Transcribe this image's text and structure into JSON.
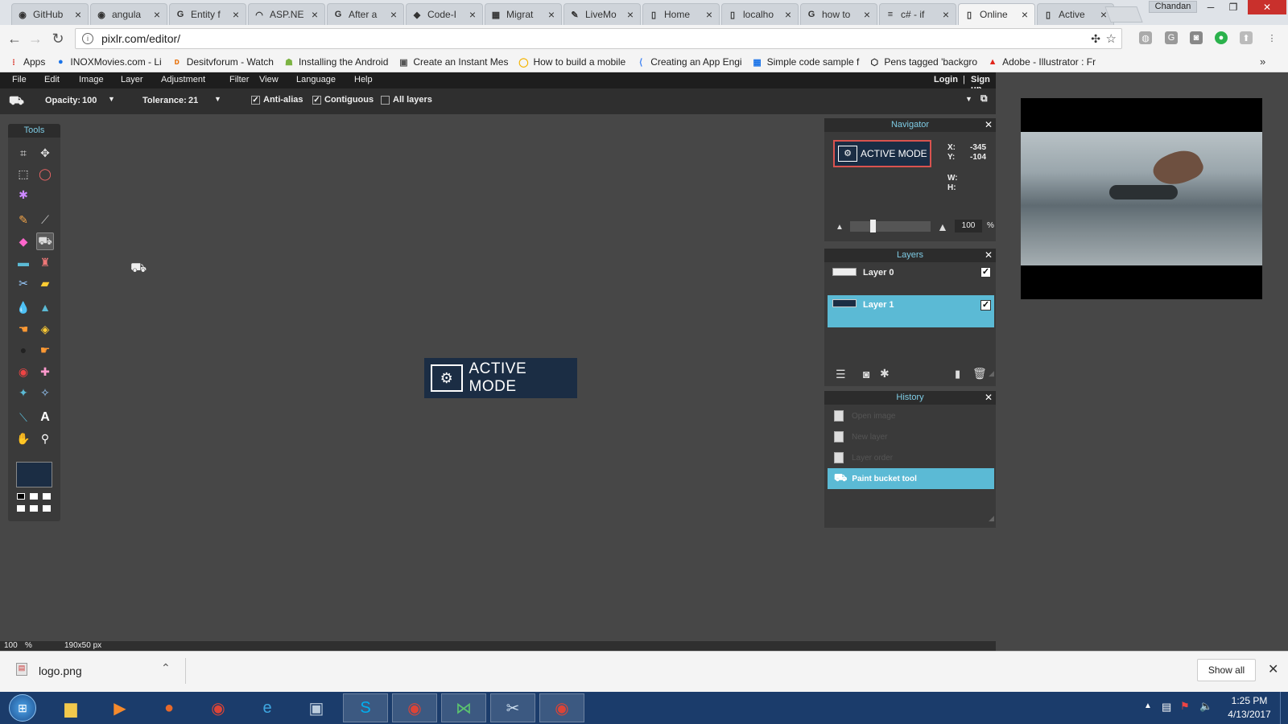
{
  "browser": {
    "tabs": [
      {
        "icon": "github-icon",
        "glyph": "◉",
        "title": "GitHub"
      },
      {
        "icon": "github-icon",
        "glyph": "◉",
        "title": "angula"
      },
      {
        "icon": "google-icon",
        "glyph": "G",
        "title": "Entity f"
      },
      {
        "icon": "aspnet-icon",
        "glyph": "◠",
        "title": "ASP.NE"
      },
      {
        "icon": "google-icon",
        "glyph": "G",
        "title": "After a"
      },
      {
        "icon": "codeproject-icon",
        "glyph": "◆",
        "title": "Code-I"
      },
      {
        "icon": "microsoft-icon",
        "glyph": "▦",
        "title": "Migrat"
      },
      {
        "icon": "livemocha-icon",
        "glyph": "✎",
        "title": "LiveMo"
      },
      {
        "icon": "page-icon",
        "glyph": "▯",
        "title": "Home"
      },
      {
        "icon": "page-icon",
        "glyph": "▯",
        "title": "localho"
      },
      {
        "icon": "google-icon",
        "glyph": "G",
        "title": "how to"
      },
      {
        "icon": "stackoverflow-icon",
        "glyph": "≡",
        "title": "c# - if"
      },
      {
        "icon": "page-icon",
        "glyph": "▯",
        "title": "Online"
      },
      {
        "icon": "page-icon",
        "glyph": "▯",
        "title": "Active"
      }
    ],
    "active_tab": 12,
    "user": "Chandan",
    "url": "pixlr.com/editor/",
    "bookmarks": [
      {
        "icon": "apps-icon",
        "label": "Apps"
      },
      {
        "icon": "inox-icon",
        "label": "INOXMovies.com - Li"
      },
      {
        "icon": "desitv-icon",
        "label": "Desitvforum - Watch"
      },
      {
        "icon": "android-icon",
        "label": "Installing the Android"
      },
      {
        "icon": "messenger-icon",
        "label": "Create an Instant Mes"
      },
      {
        "icon": "globe-icon",
        "label": "How to build a mobile"
      },
      {
        "icon": "appengine-icon",
        "label": "Creating an App Engi"
      },
      {
        "icon": "code-icon",
        "label": "Simple code sample f"
      },
      {
        "icon": "codepen-icon",
        "label": "Pens tagged 'backgro"
      },
      {
        "icon": "adobe-icon",
        "label": "Adobe - Illustrator : Fr"
      }
    ]
  },
  "pixlr": {
    "menu": [
      "File",
      "Edit",
      "Image",
      "Layer",
      "Adjustment",
      "Filter",
      "View",
      "Language",
      "Help"
    ],
    "login": "Login",
    "separator": "|",
    "signup": "Sign up",
    "options": {
      "opacity_label": "Opacity:",
      "opacity_value": "100",
      "tolerance_label": "Tolerance:",
      "tolerance_value": "21",
      "antialias_label": "Anti-alias",
      "antialias_checked": true,
      "contiguous_label": "Contiguous",
      "contiguous_checked": true,
      "alllayers_label": "All layers",
      "alllayers_checked": false
    },
    "tools_title": "Tools",
    "logo_text": "ACTIVE MODE",
    "navigator": {
      "title": "Navigator",
      "x_label": "X:",
      "x_value": "-345",
      "y_label": "Y:",
      "y_value": "-104",
      "w_label": "W:",
      "h_label": "H:",
      "zoom": "100",
      "zoom_unit": "%"
    },
    "layers": {
      "title": "Layers",
      "items": [
        {
          "name": "Layer 0",
          "visible": true,
          "selected": false
        },
        {
          "name": "Layer 1",
          "visible": true,
          "selected": true
        }
      ]
    },
    "history": {
      "title": "History",
      "items": [
        {
          "label": "Open image",
          "selected": false
        },
        {
          "label": "New layer",
          "selected": false
        },
        {
          "label": "Layer order",
          "selected": false
        },
        {
          "label": "Paint bucket tool",
          "selected": true
        }
      ]
    },
    "status": {
      "zoom": "100",
      "zoom_unit": "%",
      "size": "190x50 px"
    },
    "colors": {
      "primary": "#1b2d44",
      "accent": "#5bbad5"
    }
  },
  "download": {
    "file": "logo.png",
    "show_all": "Show all"
  },
  "taskbar": {
    "time": "1:25 PM",
    "date": "4/13/2017",
    "apps": [
      "start",
      "explorer",
      "media-player",
      "firefox",
      "chrome",
      "ie",
      "remote",
      "skype",
      "chrome",
      "visual-studio",
      "snipping-tool",
      "chrome"
    ]
  }
}
